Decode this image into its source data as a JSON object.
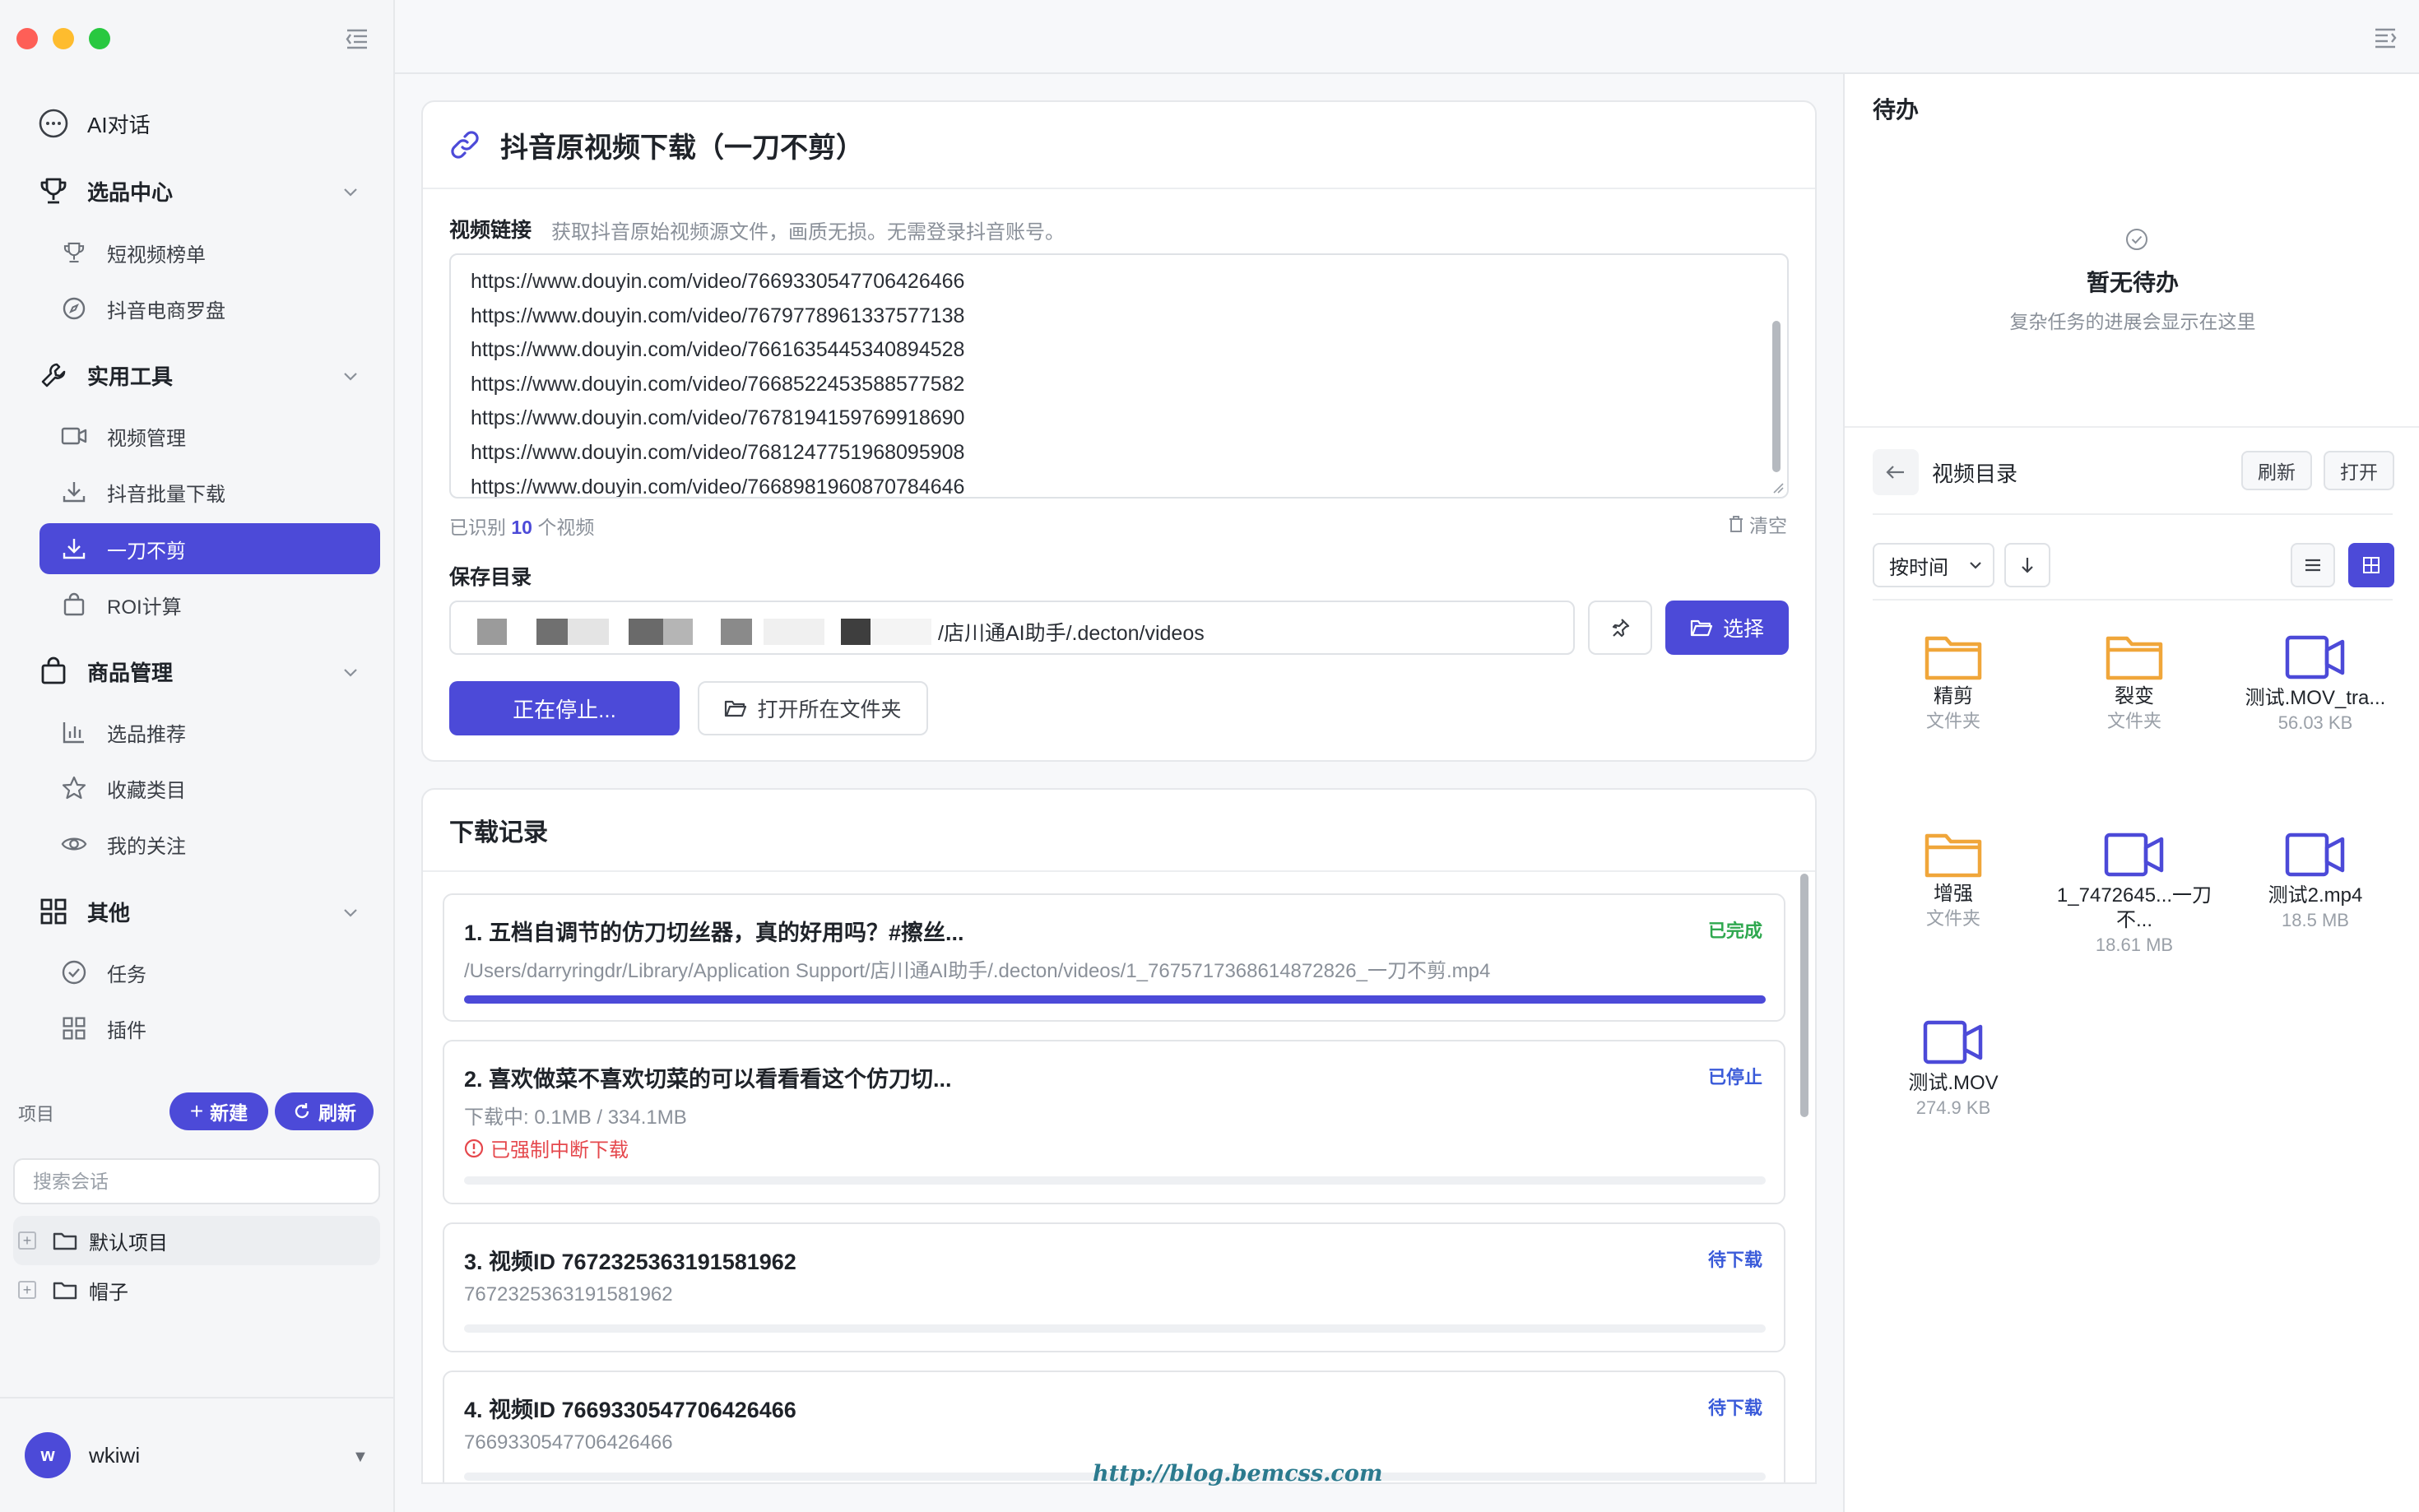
{
  "sidebar": {
    "nav": {
      "ai_chat": "AI对话",
      "selection_center": "选品中心",
      "short_video_rank": "短视频榜单",
      "douyin_compass": "抖音电商罗盘",
      "tools": "实用工具",
      "video_manage": "视频管理",
      "douyin_batch": "抖音批量下载",
      "no_cut": "一刀不剪",
      "roi": "ROI计算",
      "product_manage": "商品管理",
      "product_recommend": "选品推荐",
      "fav_category": "收藏类目",
      "my_follow": "我的关注",
      "others": "其他",
      "tasks": "任务",
      "plugins": "插件"
    },
    "projects": {
      "label": "项目",
      "new_label": "新建",
      "refresh_label": "刷新",
      "search_placeholder": "搜索会话",
      "items": [
        "默认项目",
        "帽子"
      ]
    },
    "user": {
      "initial": "w",
      "name": "wkiwi"
    }
  },
  "download": {
    "title": "抖音原视频下载（一刀不剪）",
    "link_label": "视频链接",
    "link_hint": "获取抖音原始视频源文件，画质无损。无需登录抖音账号。",
    "urls": [
      "https://www.douyin.com/video/7669330547706426466",
      "https://www.douyin.com/video/7679778961337577138",
      "https://www.douyin.com/video/7661635445340894528",
      "https://www.douyin.com/video/7668522453588577582",
      "https://www.douyin.com/video/7678194159769918690",
      "https://www.douyin.com/video/7681247751968095908",
      "https://www.douyin.com/video/7668981960870784646"
    ],
    "detected_prefix": "已识别",
    "detected_count": "10",
    "detected_suffix": "个视频",
    "clear_label": "清空",
    "save_dir_label": "保存目录",
    "save_dir_path": "/店川通AI助手/.decton/videos",
    "choose_label": "选择",
    "stop_label": "正在停止...",
    "open_folder_label": "打开所在文件夹"
  },
  "history": {
    "title": "下载记录",
    "items": [
      {
        "title": "1. 五档自调节的仿刀切丝器，真的好用吗？#擦丝...",
        "status": "已完成",
        "detail": "/Users/darryringdr/Library/Application Support/店川通AI助手/.decton/videos/1_7675717368614872826_一刀不剪.mp4",
        "progress": 1.0
      },
      {
        "title": "2. 喜欢做菜不喜欢切菜的可以看看看这个仿刀切...",
        "status": "已停止",
        "detail": "下载中: 0.1MB / 334.1MB",
        "error": "已强制中断下载",
        "progress": 0.0
      },
      {
        "title": "3. 视频ID 7672325363191581962",
        "status": "待下载",
        "detail": "7672325363191581962",
        "progress": 0.0
      },
      {
        "title": "4. 视频ID 7669330547706426466",
        "status": "待下载",
        "detail": "7669330547706426466",
        "progress": 0.0
      }
    ]
  },
  "todo": {
    "title": "待办",
    "empty_title": "暂无待办",
    "empty_sub": "复杂任务的进展会显示在这里"
  },
  "files": {
    "title": "视频目录",
    "refresh_label": "刷新",
    "open_label": "打开",
    "sort_label": "按时间",
    "items": [
      {
        "name": "精剪",
        "meta": "文件夹",
        "kind": "folder"
      },
      {
        "name": "裂变",
        "meta": "文件夹",
        "kind": "folder"
      },
      {
        "name": "测试.MOV_tra...",
        "meta": "56.03 KB",
        "kind": "video"
      },
      {
        "name": "增强",
        "meta": "文件夹",
        "kind": "folder"
      },
      {
        "name": "1_7472645...一刀不...",
        "meta": "18.61 MB",
        "kind": "video"
      },
      {
        "name": "测试2.mp4",
        "meta": "18.5 MB",
        "kind": "video"
      },
      {
        "name": "测试.MOV",
        "meta": "274.9 KB",
        "kind": "video"
      }
    ]
  },
  "watermark": "http://blog.bemcss.com",
  "colors": {
    "accent": "#4c4ad8",
    "folder": "#f0a63a",
    "done": "#2fa84f",
    "error": "#e5484d"
  }
}
